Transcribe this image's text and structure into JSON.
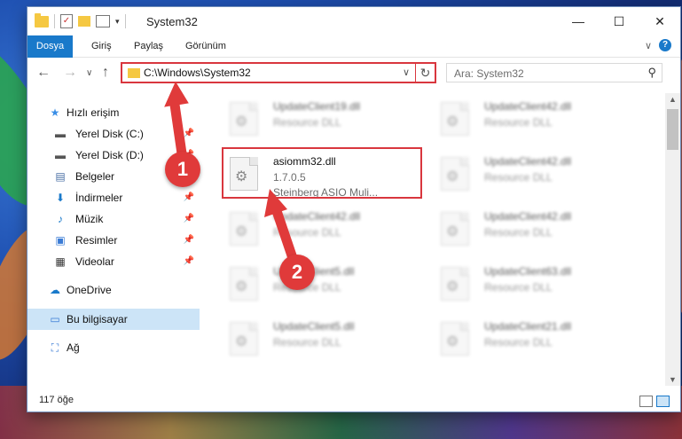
{
  "window": {
    "title": "System32",
    "controls": {
      "minimize": "—",
      "maximize": "☐",
      "close": "✕"
    }
  },
  "quick_access": {
    "check": "✓",
    "dropdown": "▾"
  },
  "ribbon": {
    "tabs": [
      "Dosya",
      "Giriş",
      "Paylaş",
      "Görünüm"
    ],
    "expand": "∨",
    "help": "?"
  },
  "nav": {
    "back": "←",
    "forward": "→",
    "history": "∨",
    "up": "↑",
    "address": "C:\\Windows\\System32",
    "address_dropdown": "∨",
    "refresh": "↻",
    "search_placeholder": "Ara: System32",
    "search_icon": "⚲"
  },
  "sidebar": {
    "items": [
      {
        "label": "Hızlı erişim",
        "icon": "star-icon",
        "glyph": "★",
        "color": "#3a8ee6",
        "pinned": false
      },
      {
        "label": "Yerel Disk (C:)",
        "icon": "drive-icon",
        "glyph": "▬",
        "color": "#555555",
        "pinned": true
      },
      {
        "label": "Yerel Disk (D:)",
        "icon": "drive-icon",
        "glyph": "▬",
        "color": "#555555",
        "pinned": true
      },
      {
        "label": "Belgeler",
        "icon": "document-icon",
        "glyph": "▤",
        "color": "#4a6fa5",
        "pinned": true
      },
      {
        "label": "İndirmeler",
        "icon": "download-icon",
        "glyph": "⬇",
        "color": "#1979ca",
        "pinned": true
      },
      {
        "label": "Müzik",
        "icon": "music-icon",
        "glyph": "♪",
        "color": "#1979ca",
        "pinned": true
      },
      {
        "label": "Resimler",
        "icon": "pictures-icon",
        "glyph": "▣",
        "color": "#3a7bd5",
        "pinned": true
      },
      {
        "label": "Videolar",
        "icon": "video-icon",
        "glyph": "▦",
        "color": "#333333",
        "pinned": true
      },
      {
        "label": "OneDrive",
        "icon": "cloud-icon",
        "glyph": "☁",
        "color": "#1979ca",
        "pinned": false
      },
      {
        "label": "Bu bilgisayar",
        "icon": "computer-icon",
        "glyph": "▭",
        "color": "#3a7bd5",
        "pinned": false,
        "selected": true
      },
      {
        "label": "Ağ",
        "icon": "network-icon",
        "glyph": "⛶",
        "color": "#3a7bd5",
        "pinned": false
      }
    ],
    "pin_glyph": "📌"
  },
  "files": {
    "gear_glyph": "⚙",
    "left_column": [
      {
        "name": "UpdateClient19.dll",
        "type": "Resource DLL",
        "blurred": true
      },
      {
        "name": "asiomm32.dll",
        "version": "1.7.0.5",
        "type": "Steinberg ASIO Muli...",
        "blurred": false,
        "highlighted": true
      },
      {
        "name": "UpdateClient42.dll",
        "type": "Resource DLL",
        "blurred": true
      },
      {
        "name": "UpdateClient5.dll",
        "type": "Resource DLL",
        "blurred": true
      },
      {
        "name": "UpdateClient5.dll",
        "type": "Resource DLL",
        "blurred": true
      }
    ],
    "right_column": [
      {
        "name": "UpdateClient42.dll",
        "type": "Resource DLL",
        "blurred": true
      },
      {
        "name": "UpdateClient42.dll",
        "type": "Resource DLL",
        "blurred": true
      },
      {
        "name": "UpdateClient42.dll",
        "type": "Resource DLL",
        "blurred": true
      },
      {
        "name": "UpdateClient63.dll",
        "type": "Resource DLL",
        "blurred": true
      },
      {
        "name": "UpdateClient21.dll",
        "type": "Resource DLL",
        "blurred": true
      }
    ]
  },
  "scrollbar": {
    "up": "▲",
    "down": "▼"
  },
  "status": {
    "count": "117 öğe"
  },
  "annotations": {
    "badge1": "1",
    "badge2": "2",
    "color": "#e03a3a"
  }
}
